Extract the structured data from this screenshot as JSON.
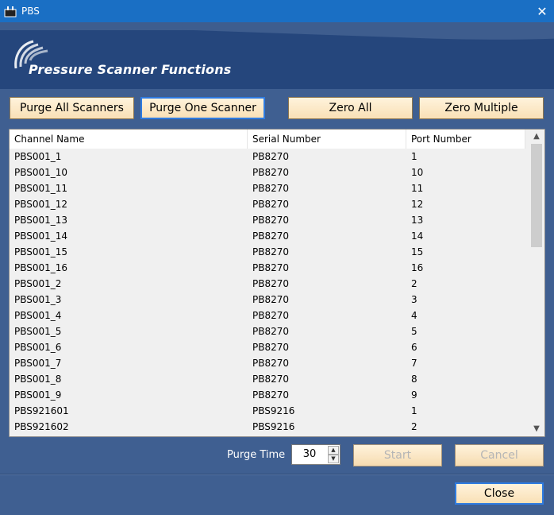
{
  "window": {
    "title": "PBS"
  },
  "banner": {
    "heading": "Pressure Scanner Functions"
  },
  "toolbar": {
    "purge_all": "Purge All Scanners",
    "purge_one": "Purge One Scanner",
    "zero_all": "Zero All",
    "zero_multiple": "Zero Multiple"
  },
  "table": {
    "columns": [
      "Channel Name",
      "Serial Number",
      "Port Number"
    ],
    "rows": [
      [
        "PBS001_1",
        "PB8270",
        "1"
      ],
      [
        "PBS001_10",
        "PB8270",
        "10"
      ],
      [
        "PBS001_11",
        "PB8270",
        "11"
      ],
      [
        "PBS001_12",
        "PB8270",
        "12"
      ],
      [
        "PBS001_13",
        "PB8270",
        "13"
      ],
      [
        "PBS001_14",
        "PB8270",
        "14"
      ],
      [
        "PBS001_15",
        "PB8270",
        "15"
      ],
      [
        "PBS001_16",
        "PB8270",
        "16"
      ],
      [
        "PBS001_2",
        "PB8270",
        "2"
      ],
      [
        "PBS001_3",
        "PB8270",
        "3"
      ],
      [
        "PBS001_4",
        "PB8270",
        "4"
      ],
      [
        "PBS001_5",
        "PB8270",
        "5"
      ],
      [
        "PBS001_6",
        "PB8270",
        "6"
      ],
      [
        "PBS001_7",
        "PB8270",
        "7"
      ],
      [
        "PBS001_8",
        "PB8270",
        "8"
      ],
      [
        "PBS001_9",
        "PB8270",
        "9"
      ],
      [
        "PBS921601",
        "PBS9216",
        "1"
      ],
      [
        "PBS921602",
        "PBS9216",
        "2"
      ]
    ]
  },
  "purge": {
    "label": "Purge Time",
    "value": "30"
  },
  "actions": {
    "start": "Start",
    "cancel": "Cancel",
    "close": "Close"
  },
  "colors": {
    "titlebar": "#1a6fc4",
    "background": "#3f5f91",
    "button": "#fbe4bd",
    "selected_border": "#2f7be0"
  }
}
